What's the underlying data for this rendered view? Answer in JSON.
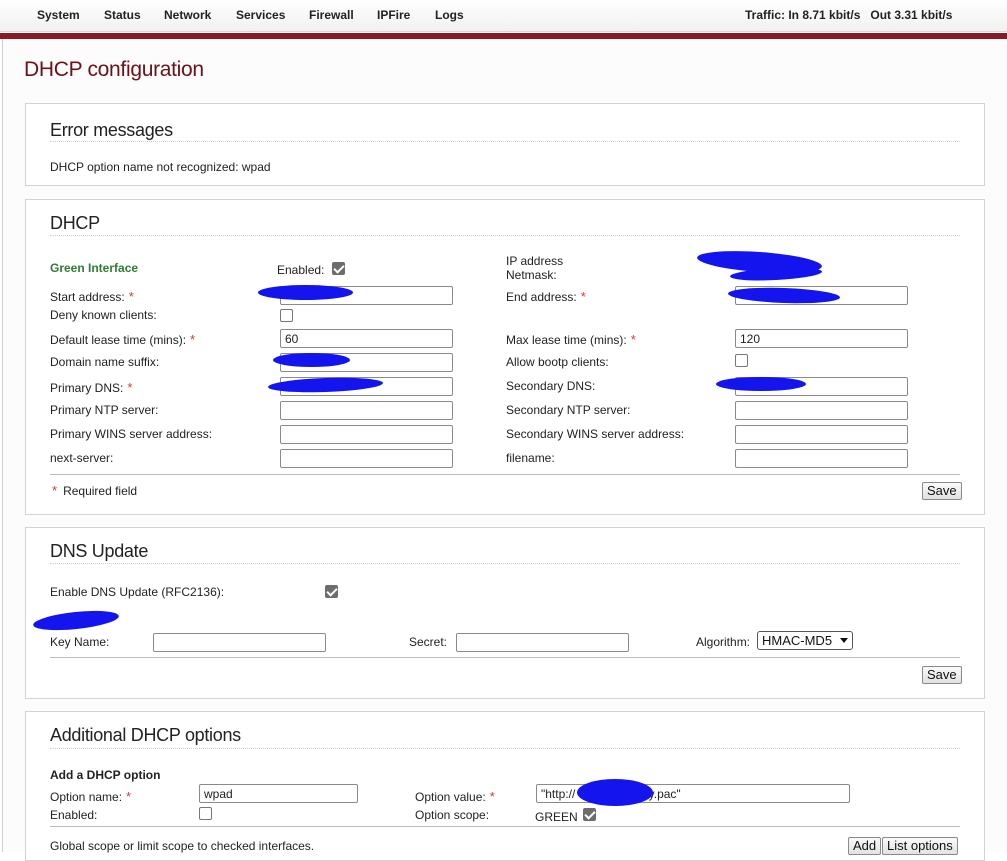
{
  "nav": {
    "items": [
      "System",
      "Status",
      "Network",
      "Services",
      "Firewall",
      "IPFire",
      "Logs"
    ],
    "traffic": "Traffic: In 8.71 kbit/s   Out 3.31 kbit/s"
  },
  "page": {
    "title": "DHCP configuration"
  },
  "errors": {
    "title": "Error messages",
    "message": "DHCP option name not recognized: wpad"
  },
  "dhcp": {
    "title": "DHCP",
    "interface": "Green Interface",
    "enabled_label": "Enabled:",
    "ip_address_label": "IP address",
    "netmask_label": "Netmask:",
    "start_label": "Start address:",
    "end_label": "End address:",
    "deny_label": "Deny known clients:",
    "default_lease_label": "Default lease time (mins):",
    "default_lease_value": "60",
    "max_lease_label": "Max lease time (mins):",
    "max_lease_value": "120",
    "domain_suffix_label": "Domain name suffix:",
    "bootp_label": "Allow bootp clients:",
    "primary_dns_label": "Primary DNS:",
    "secondary_dns_label": "Secondary DNS:",
    "primary_ntp_label": "Primary NTP server:",
    "secondary_ntp_label": "Secondary NTP server:",
    "primary_wins_label": "Primary WINS server address:",
    "secondary_wins_label": "Secondary WINS server address:",
    "next_server_label": "next-server:",
    "filename_label": "filename:",
    "required_note": "Required field",
    "save_label": "Save"
  },
  "dns_update": {
    "title": "DNS Update",
    "enable_label": "Enable DNS Update (RFC2136):",
    "key_name_label": "Key Name:",
    "secret_label": "Secret:",
    "algorithm_label": "Algorithm:",
    "algorithm_value": "HMAC-MD5",
    "save_label": "Save"
  },
  "additional": {
    "title": "Additional DHCP options",
    "add_heading": "Add a DHCP option",
    "option_name_label": "Option name:",
    "option_name_value": "wpad",
    "option_value_label": "Option value:",
    "option_value_value": "\"http://              /proxy.pac\"",
    "enabled_label": "Enabled:",
    "scope_label": "Option scope:",
    "scope_value": "GREEN",
    "footer_text": "Global scope or limit scope to checked interfaces.",
    "add_label": "Add",
    "list_label": "List options"
  },
  "colors": {
    "accent": "#8b1a24",
    "title": "#6b1118",
    "green": "#2e7d32",
    "required": "#d23a3a",
    "redaction": "#1414ee"
  }
}
